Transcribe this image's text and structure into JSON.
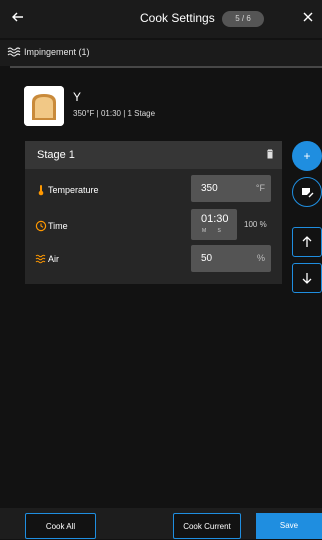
{
  "header": {
    "title": "Cook Settings",
    "step": "5 / 6",
    "back_icon": "arrow-left-icon",
    "close_icon": "close-icon"
  },
  "mode": {
    "label": "Impingement (1)",
    "icon": "waves-icon"
  },
  "recipe": {
    "name": "Y",
    "summary": "350°F | 01:30 | 1 Stage",
    "image": "toast-icon"
  },
  "stage": {
    "title": "Stage 1",
    "delete_icon": "trash-icon",
    "rows": [
      {
        "label": "Temperature",
        "value": "350",
        "unit": "°F",
        "icon": "thermometer-icon"
      },
      {
        "label": "Time",
        "value": "01:30",
        "sub": "M  S",
        "extra": "100 %",
        "icon": "clock-icon"
      },
      {
        "label": "Air",
        "value": "50",
        "unit": "%",
        "icon": "waves-icon"
      }
    ]
  },
  "side_actions": {
    "add": "+",
    "add_icon": "plus-icon",
    "edit_icon": "note-edit-icon",
    "up_icon": "arrow-up-icon",
    "down_icon": "arrow-down-icon"
  },
  "footer": {
    "cook_all": "Cook All",
    "cook_current": "Cook Current",
    "save": "Save"
  },
  "colors": {
    "accent": "#1f8ee0",
    "background": "#121212",
    "card": "#262626",
    "orange": "#ff9800"
  }
}
